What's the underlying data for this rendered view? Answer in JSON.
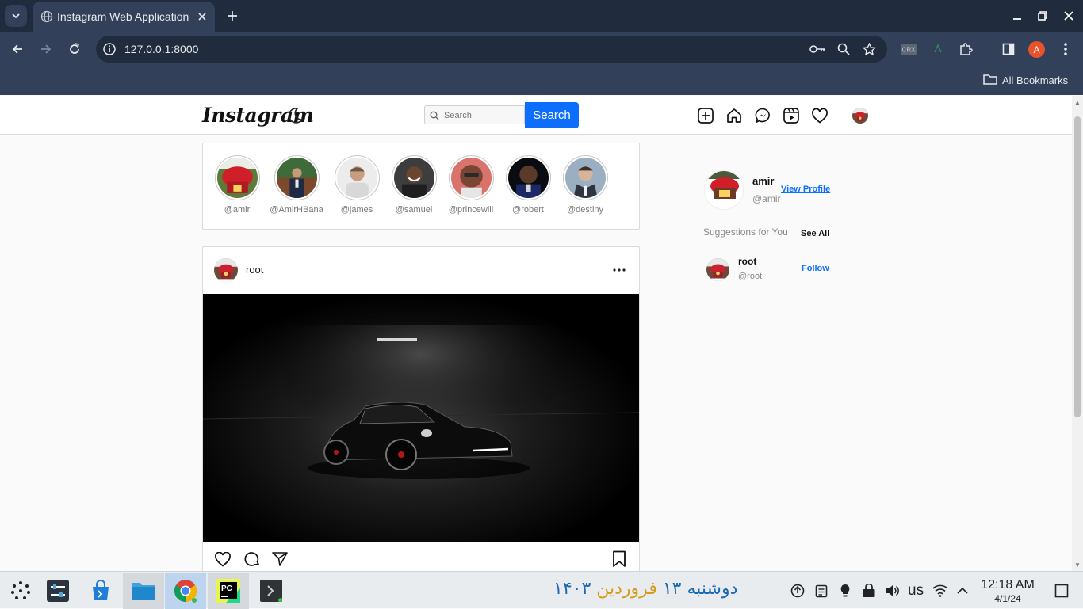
{
  "browser": {
    "tab_title": "Instagram Web Application",
    "url": "127.0.0.1:8000",
    "profile_initial": "A",
    "crx_label": "CRX",
    "bookmarks_label": "All Bookmarks"
  },
  "header": {
    "logo": "Instagram",
    "search_placeholder": "Search",
    "search_button": "Search"
  },
  "stories": [
    {
      "handle": "@amir"
    },
    {
      "handle": "@AmirHBana"
    },
    {
      "handle": "@james"
    },
    {
      "handle": "@samuel"
    },
    {
      "handle": "@princewill"
    },
    {
      "handle": "@robert"
    },
    {
      "handle": "@destiny"
    }
  ],
  "post": {
    "username": "root"
  },
  "sidebar": {
    "name": "amir",
    "handle": "@amir",
    "view_profile": "View Profile",
    "suggestions_title": "Suggestions for You",
    "see_all": "See All",
    "suggestions": [
      {
        "name": "root",
        "handle": "@root",
        "action": "Follow"
      }
    ]
  },
  "taskbar": {
    "date_day": "دوشنبه ۱۳",
    "date_month": "فروردین",
    "date_year": "۱۴۰۳",
    "language": "us",
    "time": "12:18 AM",
    "date": "4/1/24"
  },
  "colors": {
    "accent": "#0d6efd",
    "chrome_dark": "#202b3e",
    "chrome": "#33405a"
  }
}
